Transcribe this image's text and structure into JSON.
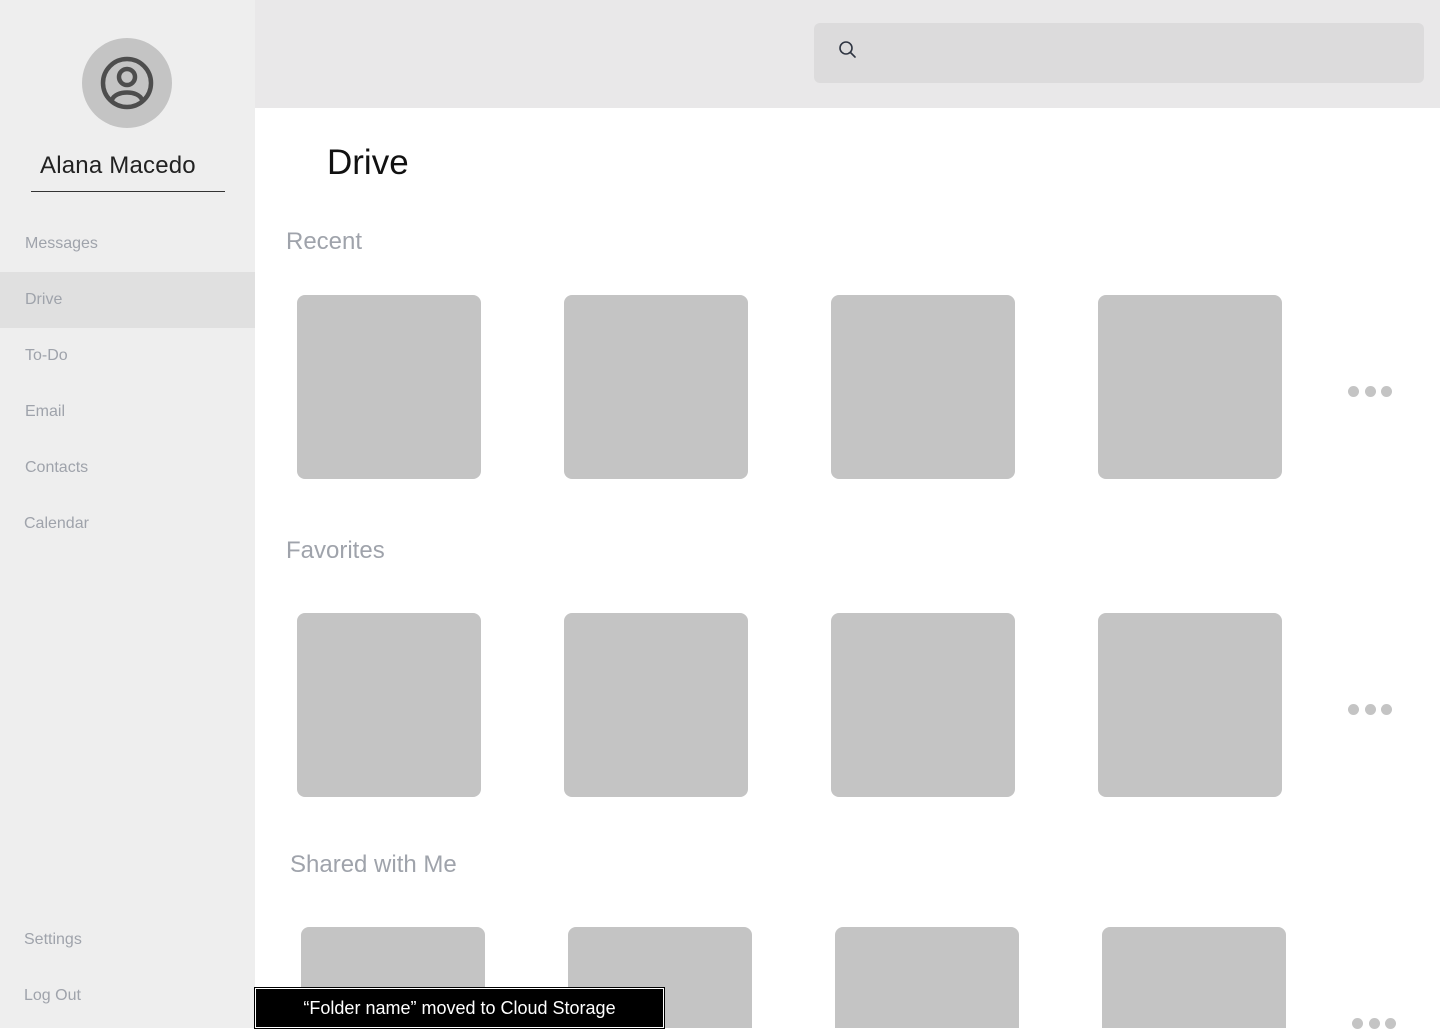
{
  "user": {
    "name": "Alana Macedo"
  },
  "nav": {
    "items": [
      {
        "label": "Messages"
      },
      {
        "label": "Drive"
      },
      {
        "label": "To-Do"
      },
      {
        "label": "Email"
      },
      {
        "label": "Contacts"
      },
      {
        "label": "Calendar"
      }
    ],
    "active": "Drive",
    "settings_label": "Settings",
    "logout_label": "Log Out"
  },
  "search": {
    "value": "",
    "placeholder": ""
  },
  "page": {
    "title": "Drive"
  },
  "sections": [
    {
      "title": "Recent",
      "tile_count": 4
    },
    {
      "title": "Favorites",
      "tile_count": 4
    },
    {
      "title": "Shared with Me",
      "tile_count": 4
    }
  ],
  "toast": {
    "message": "“Folder name” moved to Cloud Storage"
  },
  "colors": {
    "sidebar_bg": "#eeeeee",
    "active_nav_bg": "#e0e0e0",
    "topbar_bg": "#e9e8e9",
    "tile": "#c4c4c4",
    "muted_text": "#9fa3ab",
    "toast_bg": "#000000"
  }
}
